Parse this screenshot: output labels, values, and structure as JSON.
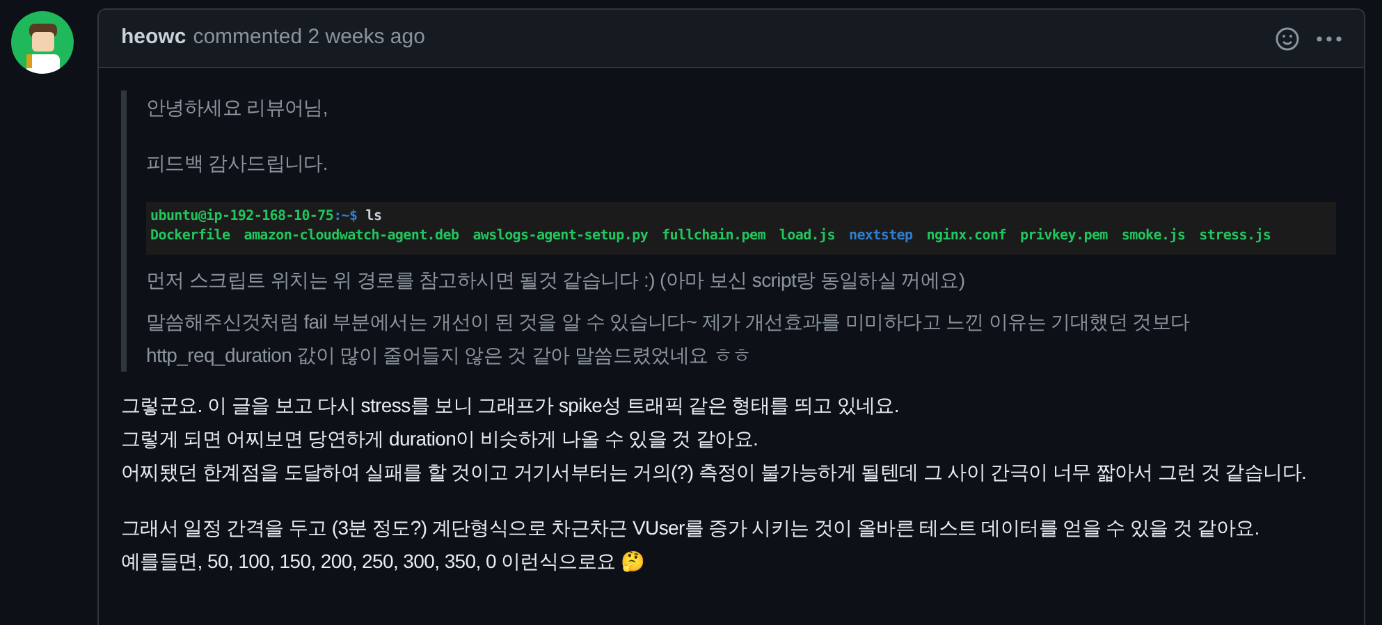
{
  "comment": {
    "author": "heowc",
    "action": "commented 2 weeks ago",
    "quote": {
      "paragraphs": [
        "안녕하세요 리뷰어님,",
        "피드백 감사드립니다."
      ],
      "terminal": {
        "prompt_host": "ubuntu@ip-192-168-10-75",
        "prompt_path": ":~$",
        "command": "ls",
        "files": [
          {
            "name": "Dockerfile",
            "kind": "file"
          },
          {
            "name": "amazon-cloudwatch-agent.deb",
            "kind": "file"
          },
          {
            "name": "awslogs-agent-setup.py",
            "kind": "file"
          },
          {
            "name": "fullchain.pem",
            "kind": "file"
          },
          {
            "name": "load.js",
            "kind": "file"
          },
          {
            "name": "nextstep",
            "kind": "dir"
          },
          {
            "name": "nginx.conf",
            "kind": "file"
          },
          {
            "name": "privkey.pem",
            "kind": "file"
          },
          {
            "name": "smoke.js",
            "kind": "file"
          },
          {
            "name": "stress.js",
            "kind": "file"
          }
        ]
      },
      "after": [
        [
          "먼저 스크립트 위치는 위 경로를 참고하시면 될것 같습니다 :) (아마 보신 script랑 동일하실 꺼에요)"
        ],
        [
          "말씀해주신것처럼 fail 부분에서는 개선이 된 것을 알 수 있습니다~ 제가 개선효과를 미미하다고 느낀 이유는 기대했던 것보다",
          "http_req_duration 값이 많이 줄어들지 않은 것 같아 말씀드렸었네요 ㅎㅎ"
        ]
      ]
    },
    "body": [
      [
        "그렇군요. 이 글을 보고 다시 stress를 보니 그래프가 spike성 트래픽 같은 형태를 띄고 있네요.",
        "그렇게 되면 어찌보면 당연하게 duration이 비슷하게 나올 수 있을 것 같아요.",
        "어찌됐던 한계점을 도달하여 실패를 할 것이고 거기서부터는 거의(?) 측정이 불가능하게 될텐데 그 사이 간극이 너무 짧아서 그런 것 같습니다."
      ],
      [
        "그래서 일정 간격을 두고 (3분 정도?) 계단형식으로 차근차근 VUser를 증가 시키는 것이 올바른 테스트 데이터를 얻을 수 있을 것 같아요.",
        "예를들면, 50, 100, 150, 200, 250, 300, 350, 0 이런식으로요 🤔"
      ]
    ]
  }
}
